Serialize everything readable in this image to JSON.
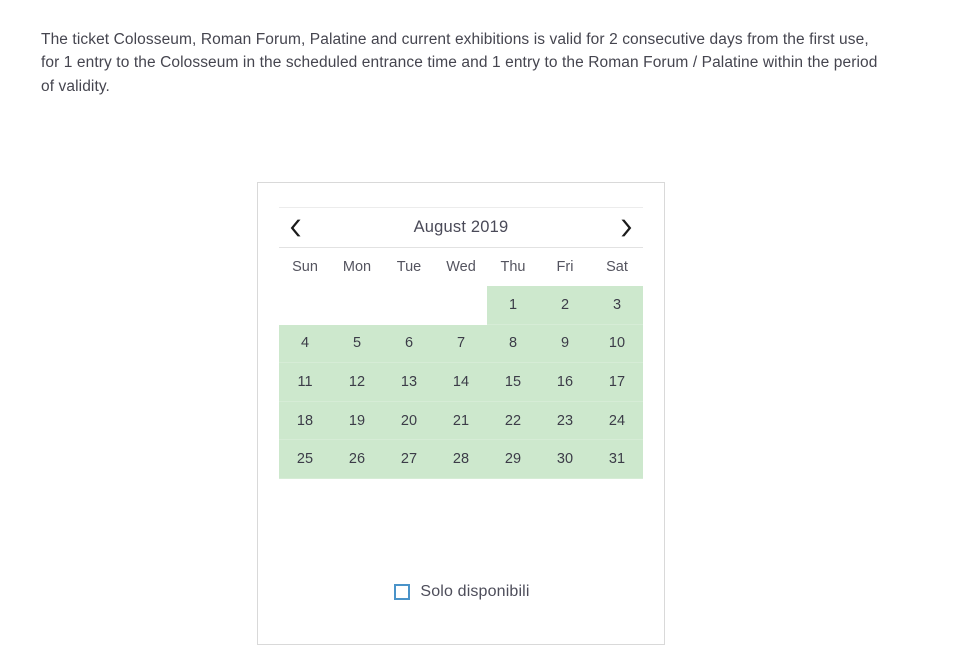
{
  "intro": {
    "text": "The ticket Colosseum, Roman Forum, Palatine and current exhibitions is valid for 2 consecutive days from the first use, for 1 entry to the Colosseum in the scheduled entrance time and 1 entry to the Roman Forum / Palatine within the period of validity."
  },
  "calendar": {
    "title": "August 2019",
    "prev_icon": "chevron-left-icon",
    "next_icon": "chevron-right-icon",
    "weekdays": [
      "Sun",
      "Mon",
      "Tue",
      "Wed",
      "Thu",
      "Fri",
      "Sat"
    ],
    "cells": [
      {
        "label": "",
        "available": false,
        "blank": true
      },
      {
        "label": "",
        "available": false,
        "blank": true
      },
      {
        "label": "",
        "available": false,
        "blank": true
      },
      {
        "label": "",
        "available": false,
        "blank": true
      },
      {
        "label": "1",
        "available": true,
        "blank": false
      },
      {
        "label": "2",
        "available": true,
        "blank": false
      },
      {
        "label": "3",
        "available": true,
        "blank": false
      },
      {
        "label": "4",
        "available": true,
        "blank": false
      },
      {
        "label": "5",
        "available": true,
        "blank": false
      },
      {
        "label": "6",
        "available": true,
        "blank": false
      },
      {
        "label": "7",
        "available": true,
        "blank": false
      },
      {
        "label": "8",
        "available": true,
        "blank": false
      },
      {
        "label": "9",
        "available": true,
        "blank": false
      },
      {
        "label": "10",
        "available": true,
        "blank": false
      },
      {
        "label": "11",
        "available": true,
        "blank": false
      },
      {
        "label": "12",
        "available": true,
        "blank": false
      },
      {
        "label": "13",
        "available": true,
        "blank": false
      },
      {
        "label": "14",
        "available": true,
        "blank": false
      },
      {
        "label": "15",
        "available": true,
        "blank": false
      },
      {
        "label": "16",
        "available": true,
        "blank": false
      },
      {
        "label": "17",
        "available": true,
        "blank": false
      },
      {
        "label": "18",
        "available": true,
        "blank": false
      },
      {
        "label": "19",
        "available": true,
        "blank": false
      },
      {
        "label": "20",
        "available": true,
        "blank": false
      },
      {
        "label": "21",
        "available": true,
        "blank": false
      },
      {
        "label": "22",
        "available": true,
        "blank": false
      },
      {
        "label": "23",
        "available": true,
        "blank": false
      },
      {
        "label": "24",
        "available": true,
        "blank": false
      },
      {
        "label": "25",
        "available": true,
        "blank": false
      },
      {
        "label": "26",
        "available": true,
        "blank": false
      },
      {
        "label": "27",
        "available": true,
        "blank": false
      },
      {
        "label": "28",
        "available": true,
        "blank": false
      },
      {
        "label": "29",
        "available": true,
        "blank": false
      },
      {
        "label": "30",
        "available": true,
        "blank": false
      },
      {
        "label": "31",
        "available": true,
        "blank": false
      }
    ],
    "filter": {
      "label": "Solo disponibili",
      "checked": false
    },
    "colors": {
      "available_background": "#cde8cd",
      "checkbox_border": "#4a93c9",
      "card_border": "#d9d9d9",
      "text": "#3c3c48"
    }
  }
}
